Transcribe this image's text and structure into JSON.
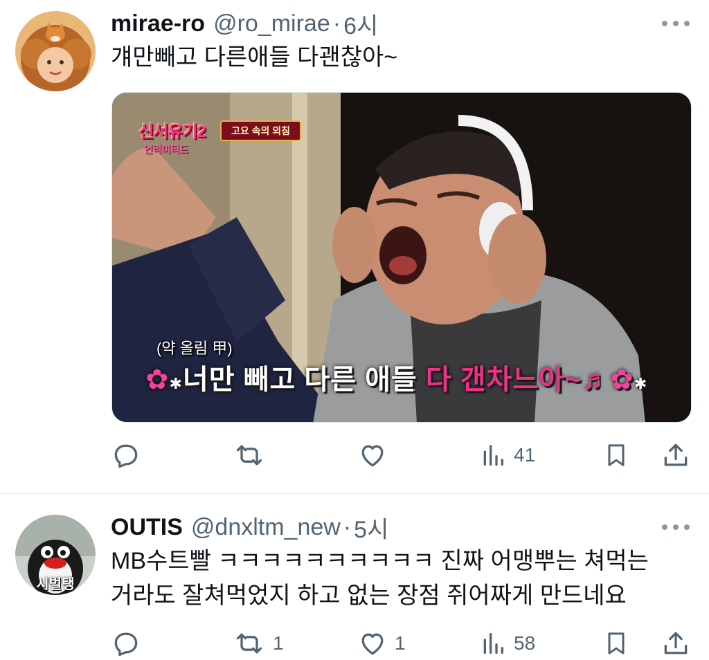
{
  "tweets": [
    {
      "display_name": "mirae-ro",
      "handle": "@ro_mirae",
      "separator": "·",
      "time": "6시",
      "text": "걔만빼고 다른애들 다괜찮아~",
      "media": {
        "show_logo": "신서유기2",
        "show_logo_sub": "언리미티드",
        "segment_title": "고요 속의 외침",
        "caption_small": "(약 올림 甲)",
        "caption_main_white": "너만 빼고 다른 애들 ",
        "caption_main_pink": "다 갠차느아~",
        "caption_music": "♬"
      },
      "actions": {
        "reply_count": "",
        "retweet_count": "",
        "like_count": "",
        "view_count": "41"
      }
    },
    {
      "display_name": "OUTIS",
      "handle": "@dnxltm_new",
      "separator": "·",
      "time": "5시",
      "text_line1": "MB수트빨 ㅋㅋㅋㅋㅋㅋㅋㅋㅋㅋ 진짜 어맹뿌는 쳐먹는",
      "text_line2": "거라도 잘쳐먹었지 하고 없는 장점 쥐어짜게 만드네요",
      "avatar_label": "시벌탱",
      "actions": {
        "reply_count": "",
        "retweet_count": "1",
        "like_count": "1",
        "view_count": "58"
      }
    }
  ],
  "colors": {
    "text_primary": "#0f1419",
    "text_secondary": "#536471",
    "divider": "#e6e9ec",
    "caption_pink": "#f0318a"
  },
  "icons": [
    "reply-icon",
    "retweet-icon",
    "like-icon",
    "views-icon",
    "bookmark-icon",
    "share-icon",
    "more-icon"
  ]
}
